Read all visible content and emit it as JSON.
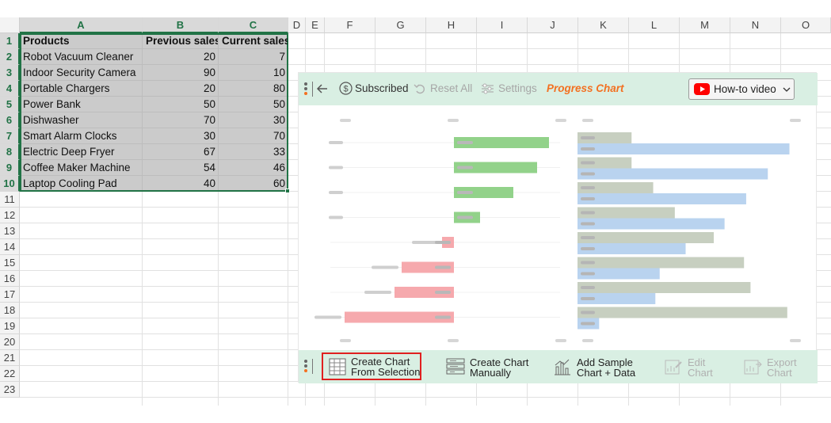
{
  "sheet": {
    "columns": [
      "A",
      "B",
      "C",
      "D",
      "E",
      "F",
      "G",
      "H",
      "I",
      "J",
      "K",
      "L",
      "M",
      "N",
      "O"
    ],
    "selected_columns": [
      "A",
      "B",
      "C"
    ],
    "rows": [
      "1",
      "2",
      "3",
      "4",
      "5",
      "6",
      "7",
      "8",
      "9",
      "10",
      "11",
      "12",
      "13",
      "14",
      "15",
      "16",
      "17",
      "18",
      "19",
      "20",
      "21",
      "22",
      "23"
    ],
    "selected_rows": [
      "1",
      "2",
      "3",
      "4",
      "5",
      "6",
      "7",
      "8",
      "9",
      "10"
    ],
    "headers": [
      "Products",
      "Previous sales",
      "Current sales"
    ],
    "data": [
      [
        "Robot Vacuum Cleaner",
        "20",
        "7"
      ],
      [
        "Indoor Security Camera",
        "90",
        "10"
      ],
      [
        "Portable Chargers",
        "20",
        "80"
      ],
      [
        "Power Bank",
        "50",
        "50"
      ],
      [
        "Dishwasher",
        "70",
        "30"
      ],
      [
        "Smart Alarm Clocks",
        "30",
        "70"
      ],
      [
        "Electric Deep Fryer",
        "67",
        "33"
      ],
      [
        "Coffee Maker Machine",
        "54",
        "46"
      ],
      [
        "Laptop Cooling Pad",
        "40",
        "60"
      ]
    ]
  },
  "addin": {
    "toolbar": {
      "back_icon": "arrow-left-icon",
      "subscribed": "Subscribed",
      "reset_all": "Reset All",
      "settings": "Settings",
      "chart_name": "Progress Chart",
      "howto": "How-to video",
      "colors": {
        "accent": "#f37021",
        "bar_bg": "#d9efe3",
        "youtube": "#ff0000"
      }
    },
    "bottombar": {
      "create_from_selection": [
        "Create Chart",
        "From Selection"
      ],
      "create_manually": [
        "Create Chart",
        "Manually"
      ],
      "add_sample": [
        "Add Sample",
        "Chart + Data"
      ],
      "edit_chart": [
        "Edit",
        "Chart"
      ],
      "export_chart": [
        "Export",
        "Chart"
      ]
    },
    "preview": {
      "colors": {
        "positive": "#92d28a",
        "negative": "#f6a9ad",
        "previous": "#c7cfc0",
        "current": "#b9d3ef"
      },
      "progress_bars": [
        40,
        35,
        25,
        11,
        -5,
        -22,
        -25,
        -46
      ],
      "compare_bars": [
        {
          "previous": 25,
          "current": 98
        },
        {
          "previous": 25,
          "current": 88
        },
        {
          "previous": 35,
          "current": 78
        },
        {
          "previous": 45,
          "current": 68
        },
        {
          "previous": 63,
          "current": 50
        },
        {
          "previous": 77,
          "current": 38
        },
        {
          "previous": 80,
          "current": 36
        },
        {
          "previous": 97,
          "current": 10
        }
      ]
    }
  }
}
